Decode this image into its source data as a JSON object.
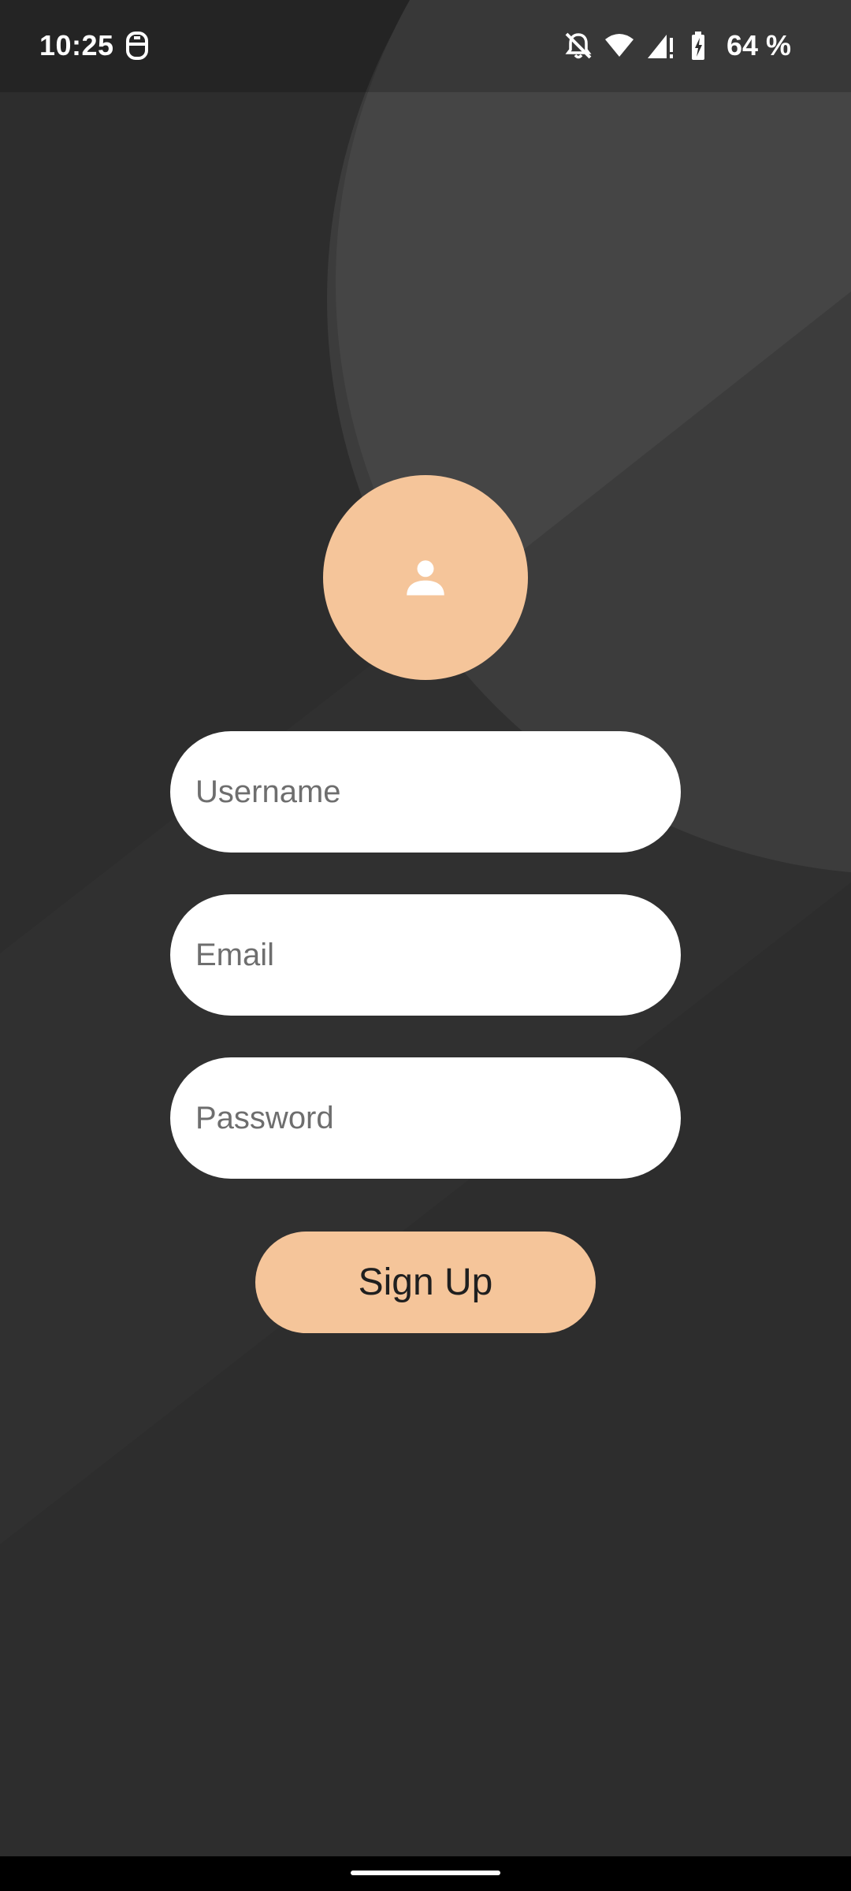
{
  "status_bar": {
    "time": "10:25",
    "left_icon": "privacy-indicator-icon",
    "icons": [
      "notifications-off-icon",
      "wifi-icon",
      "signal-icon",
      "battery-charging-icon"
    ],
    "battery_text": "64 %"
  },
  "signup": {
    "avatar_icon": "person-icon",
    "username_placeholder": "Username",
    "email_placeholder": "Email",
    "password_placeholder": "Password",
    "button_label": "Sign Up"
  },
  "colors": {
    "background": "#2d2d2d",
    "accent": "#f5c59a",
    "field_background": "#ffffff",
    "decor_circle": "#444444",
    "decor_shadow": "#3a3a3a"
  }
}
